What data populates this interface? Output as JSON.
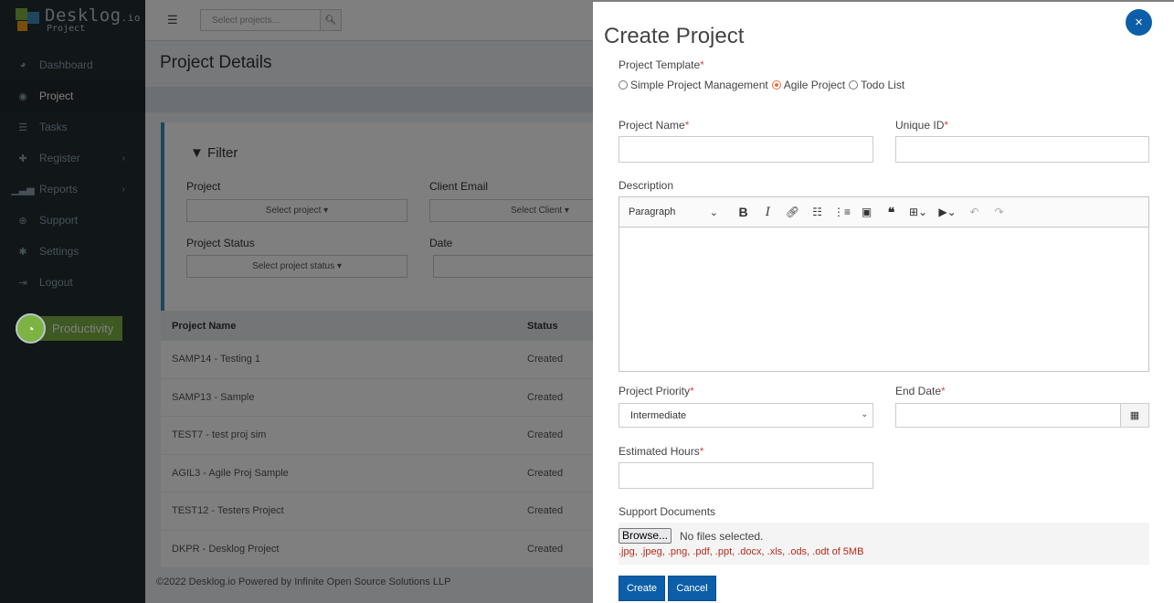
{
  "sidebar": {
    "logo_main": "Desklog",
    "logo_suffix": ".io",
    "logo_sub": "Project",
    "items": [
      {
        "label": "Dashboard",
        "icon": "dashboard-icon"
      },
      {
        "label": "Project",
        "icon": "project-icon"
      },
      {
        "label": "Tasks",
        "icon": "tasks-icon"
      },
      {
        "label": "Register",
        "icon": "plus-icon"
      },
      {
        "label": "Reports",
        "icon": "bar-chart-icon"
      },
      {
        "label": "Support",
        "icon": "support-icon"
      },
      {
        "label": "Settings",
        "icon": "gear-icon"
      },
      {
        "label": "Logout",
        "icon": "logout-icon"
      }
    ],
    "productivity_label": "Productivity"
  },
  "topbar": {
    "search_placeholder": "Select projects..."
  },
  "page": {
    "title": "Project Details",
    "filter": {
      "title": "Filter",
      "project_label": "Project",
      "project_select": "Select project",
      "client_email_label": "Client Email",
      "client_select": "Select Client",
      "status_label": "Project Status",
      "status_select": "Select project status",
      "date_label": "Date"
    },
    "table": {
      "headers": [
        "Project Name",
        "Status"
      ],
      "rows": [
        [
          "SAMP14 - Testing 1",
          "Created"
        ],
        [
          "SAMP13 - Sample",
          "Created"
        ],
        [
          "TEST7 - test proj sim",
          "Created"
        ],
        [
          "AGIL3 - Agile Proj Sample",
          "Created"
        ],
        [
          "TEST12 - Testers Project",
          "Created"
        ],
        [
          "DKPR - Desklog Project",
          "Created"
        ]
      ]
    },
    "footer": "©2022 Desklog.io Powered by Infinite Open Source Solutions LLP"
  },
  "modal": {
    "title": "Create Project",
    "close_label": "×",
    "template_label": "Project Template",
    "templates": [
      {
        "label": "Simple Project Management",
        "selected": false
      },
      {
        "label": "Agile Project",
        "selected": true
      },
      {
        "label": "Todo List",
        "selected": false
      }
    ],
    "project_name_label": "Project Name",
    "project_name_value": "",
    "unique_id_label": "Unique ID",
    "unique_id_value": "",
    "description_label": "Description",
    "editor_format": "Paragraph",
    "priority_label": "Project Priority",
    "priority_value": "Intermediate",
    "end_date_label": "End Date",
    "estimated_hours_label": "Estimated Hours",
    "support_docs_label": "Support Documents",
    "browse_label": "Browse...",
    "no_files_text": "No files selected.",
    "file_hint": ".jpg, .jpeg, .png, .pdf, .ppt, .docx, .xls, .ods, .odt of 5MB",
    "create_label": "Create",
    "cancel_label": "Cancel",
    "required_mark": "*"
  },
  "colors": {
    "primary": "#0d5ea8",
    "sidebar_bg": "#222d32",
    "productivity": "#7cb342",
    "required": "#dd4b39"
  }
}
